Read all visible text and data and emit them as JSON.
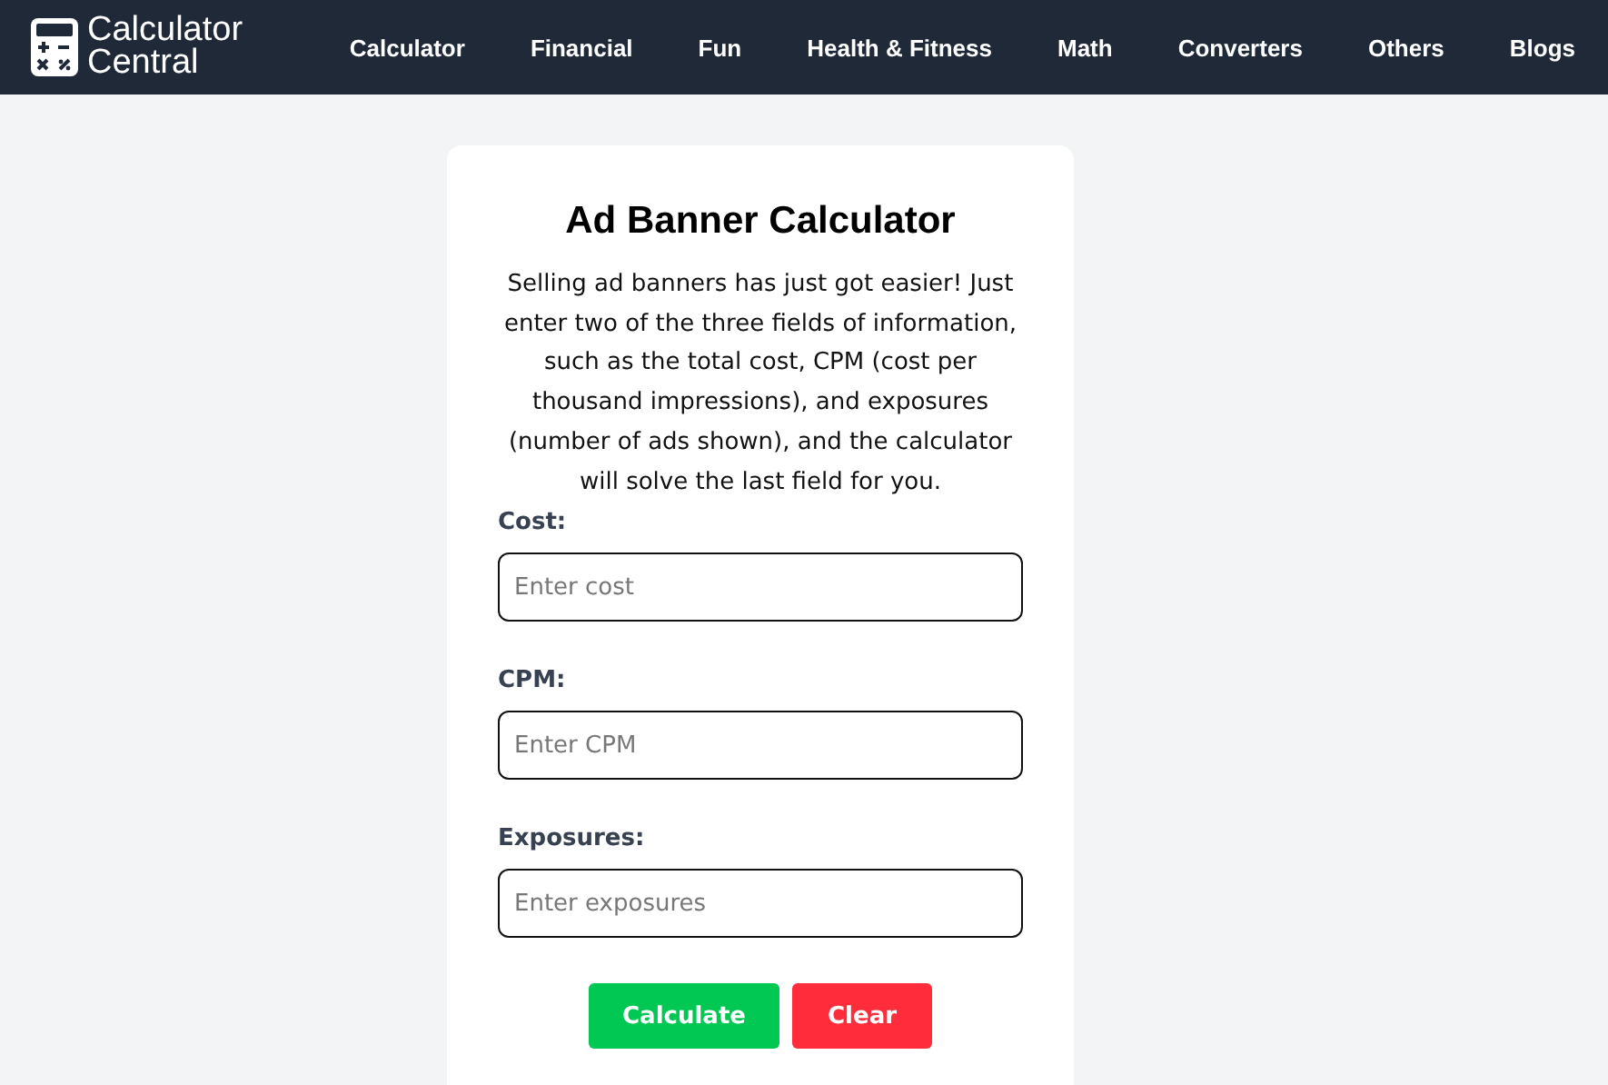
{
  "header": {
    "logo_lines": [
      "Calculator",
      "Central"
    ],
    "nav": [
      "Calculator",
      "Financial",
      "Fun",
      "Health & Fitness",
      "Math",
      "Converters",
      "Others",
      "Blogs"
    ]
  },
  "card": {
    "title": "Ad Banner Calculator",
    "description": "Selling ad banners has just got easier! Just enter two of the three fields of information, such as the total cost, CPM (cost per thousand impressions), and exposures (number of ads shown), and the calculator will solve the last field for you.",
    "fields": [
      {
        "label": "Cost:",
        "placeholder": "Enter cost"
      },
      {
        "label": "CPM:",
        "placeholder": "Enter CPM"
      },
      {
        "label": "Exposures:",
        "placeholder": "Enter exposures"
      }
    ],
    "buttons": [
      {
        "label": "Calculate",
        "kind": "primary"
      },
      {
        "label": "Clear",
        "kind": "danger"
      }
    ]
  }
}
